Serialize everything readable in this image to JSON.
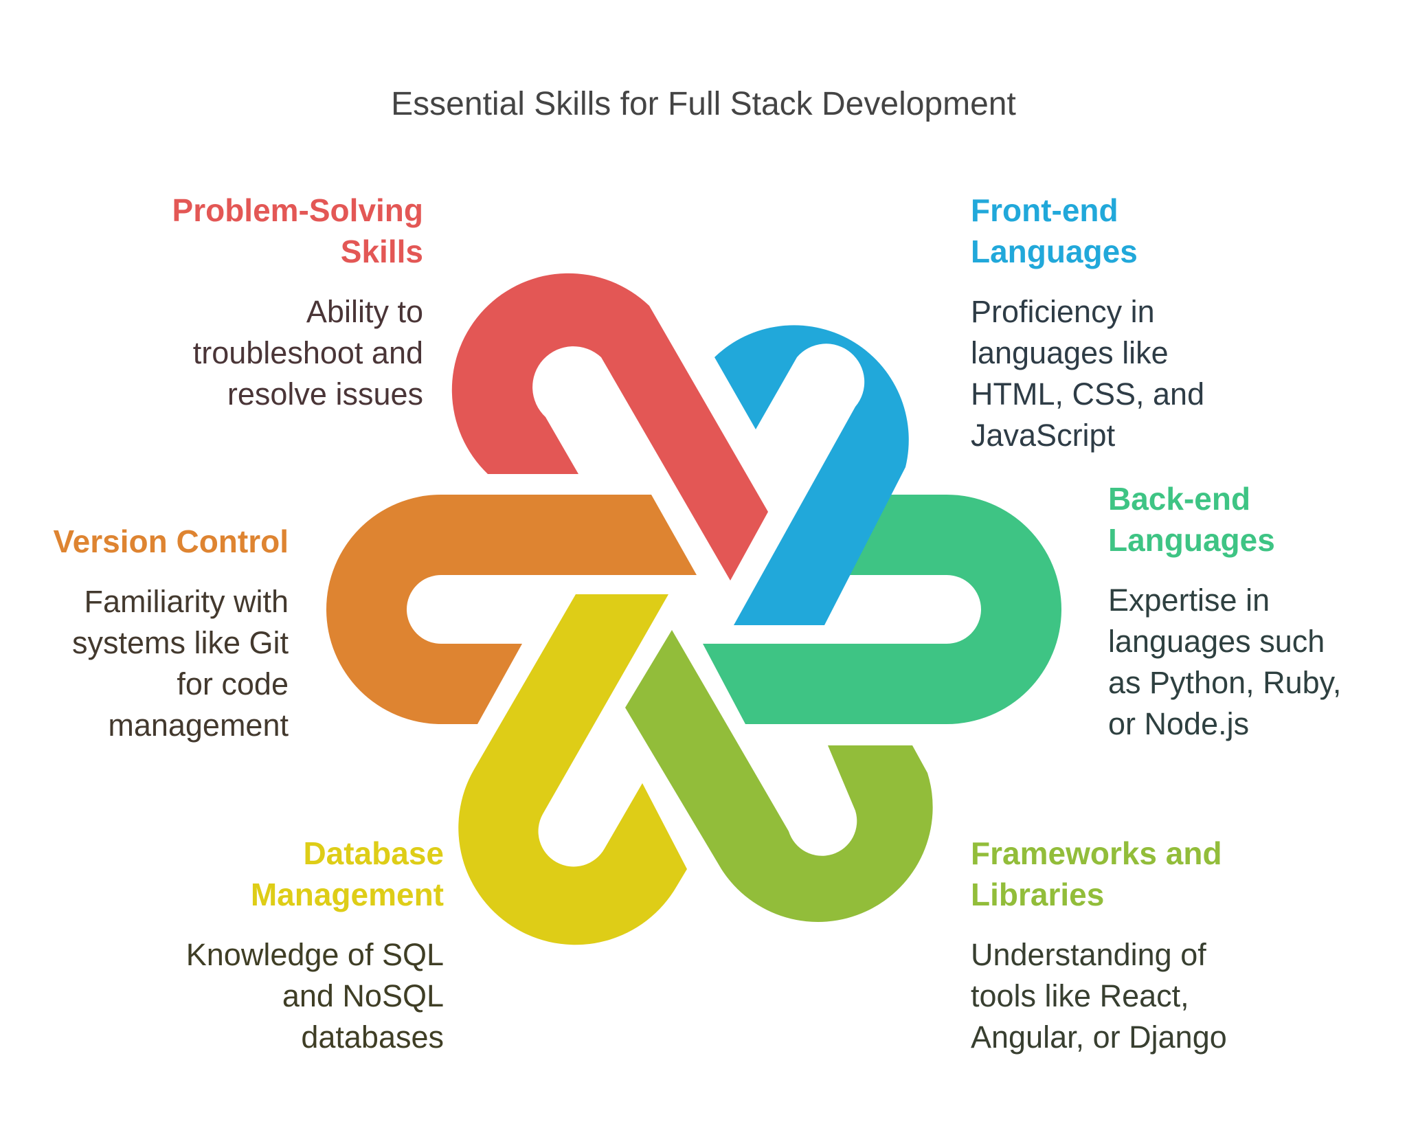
{
  "title": "Essential Skills for Full Stack Development",
  "skills": {
    "problem_solving": {
      "heading": [
        "Problem-Solving",
        "Skills"
      ],
      "description": [
        "Ability to",
        "troubleshoot and",
        "resolve issues"
      ],
      "color": "#E35755",
      "text_color": "#4A3537"
    },
    "frontend": {
      "heading": [
        "Front-end",
        "Languages"
      ],
      "description": [
        "Proficiency in",
        "languages like",
        "HTML, CSS, and",
        "JavaScript"
      ],
      "color": "#21A8DA",
      "text_color": "#2E3C46"
    },
    "backend": {
      "heading": [
        "Back-end",
        "Languages"
      ],
      "description": [
        "Expertise in",
        "languages such",
        "as Python, Ruby,",
        "or Node.js"
      ],
      "color": "#3EC484",
      "text_color": "#2E4040"
    },
    "frameworks": {
      "heading": [
        "Frameworks and",
        "Libraries"
      ],
      "description": [
        "Understanding of",
        "tools like React,",
        "Angular, or Django"
      ],
      "color": "#92BD3A",
      "text_color": "#383F30"
    },
    "database": {
      "heading": [
        "Database",
        "Management"
      ],
      "description": [
        "Knowledge of SQL",
        "and NoSQL",
        "databases"
      ],
      "color": "#DECD17",
      "text_color": "#3F3E25"
    },
    "version_control": {
      "heading": [
        "Version Control"
      ],
      "description": [
        "Familiarity with",
        "systems like Git",
        "for code",
        "management"
      ],
      "color": "#DE8431",
      "text_color": "#43392E"
    }
  }
}
